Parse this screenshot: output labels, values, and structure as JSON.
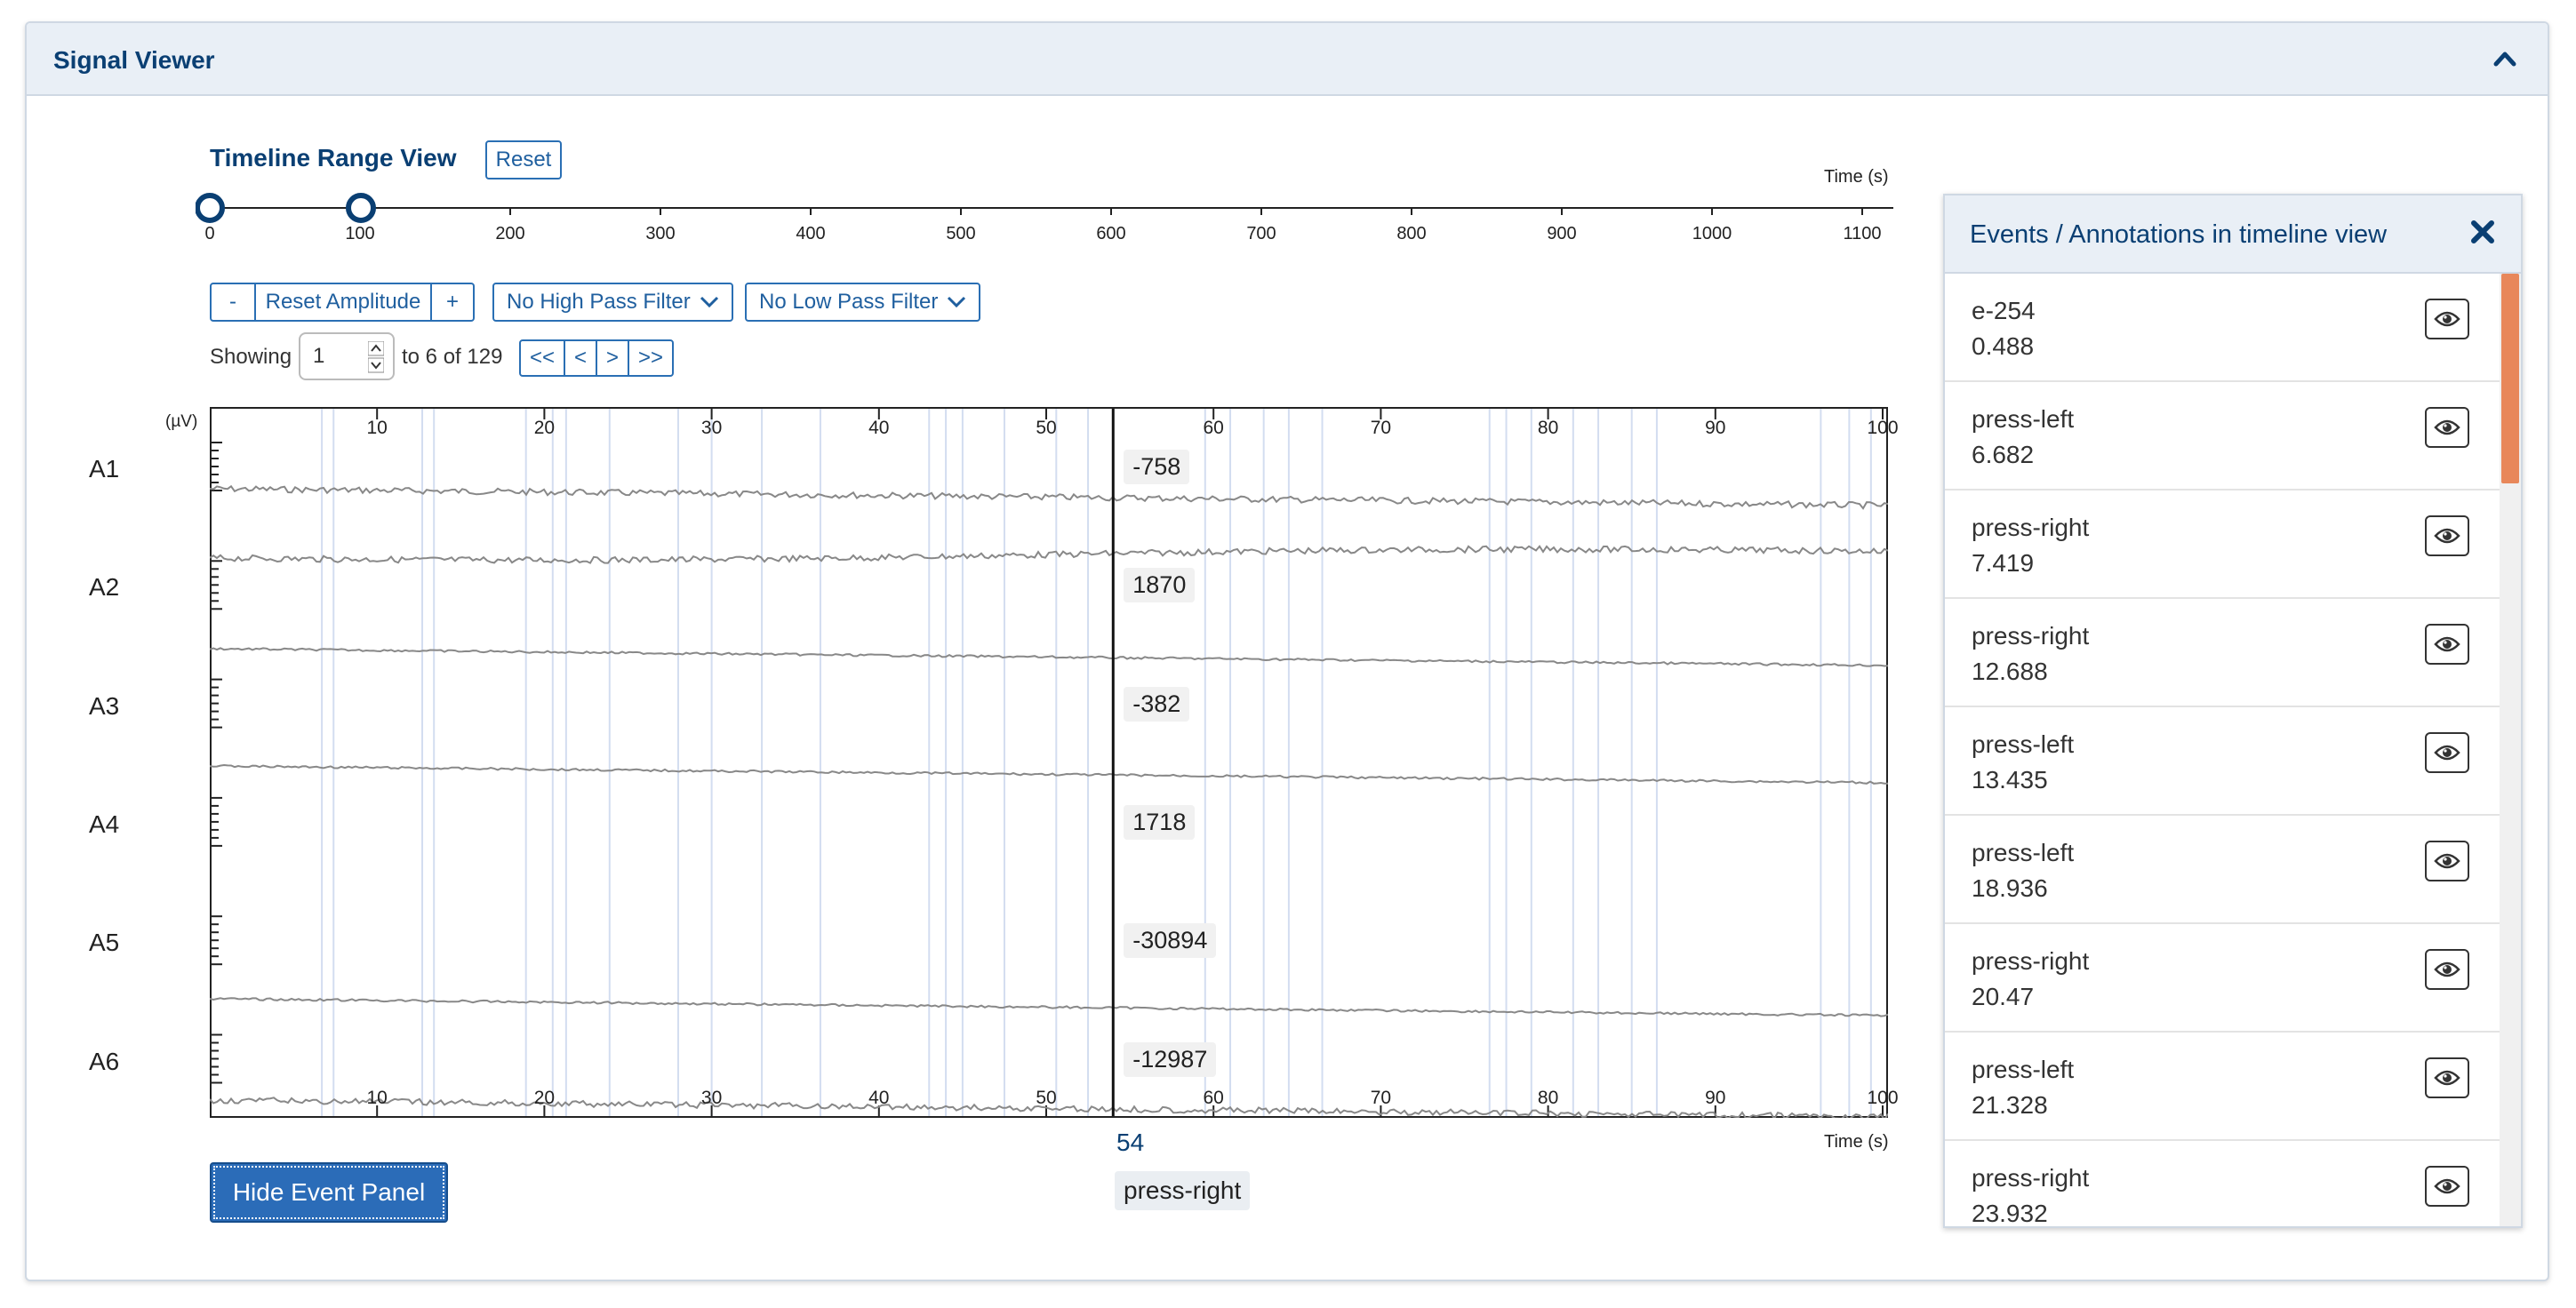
{
  "panel": {
    "title": "Signal Viewer"
  },
  "timeline": {
    "title": "Timeline Range View",
    "reset_label": "Reset",
    "axis_label": "Time (s)",
    "ticks": [
      "0",
      "100",
      "200",
      "300",
      "400",
      "500",
      "600",
      "700",
      "800",
      "900",
      "1000",
      "1100"
    ],
    "range_start": 0,
    "range_end": 100
  },
  "controls": {
    "amp_minus": "-",
    "amp_reset": "Reset Amplitude",
    "amp_plus": "+",
    "high_pass": "No High Pass Filter",
    "low_pass": "No Low Pass Filter",
    "showing_label": "Showing",
    "showing_value": "1",
    "showing_suffix": "to 6 of 129",
    "nav_first": "<<",
    "nav_prev": "<",
    "nav_next": ">",
    "nav_last": ">>"
  },
  "plot": {
    "unit_label": "(µV)",
    "axis_label": "Time (s)",
    "ticks": [
      "10",
      "20",
      "30",
      "40",
      "50",
      "60",
      "70",
      "80",
      "90",
      "100"
    ],
    "channels": [
      {
        "name": "A1",
        "value": "-758"
      },
      {
        "name": "A2",
        "value": "1870"
      },
      {
        "name": "A3",
        "value": "-382"
      },
      {
        "name": "A4",
        "value": "1718"
      },
      {
        "name": "A5",
        "value": "-30894"
      },
      {
        "name": "A6",
        "value": "-12987"
      }
    ],
    "cursor_time": "54",
    "cursor_event": "press-right"
  },
  "hide_event_panel": "Hide Event Panel",
  "events_panel": {
    "title": "Events / Annotations in timeline view",
    "items": [
      {
        "name": "e-254",
        "time": "0.488"
      },
      {
        "name": "press-left",
        "time": "6.682"
      },
      {
        "name": "press-right",
        "time": "7.419"
      },
      {
        "name": "press-right",
        "time": "12.688"
      },
      {
        "name": "press-left",
        "time": "13.435"
      },
      {
        "name": "press-left",
        "time": "18.936"
      },
      {
        "name": "press-right",
        "time": "20.47"
      },
      {
        "name": "press-left",
        "time": "21.328"
      },
      {
        "name": "press-right",
        "time": "23.932"
      }
    ]
  },
  "colors": {
    "brand": "#0a3f73",
    "accent": "#2b6cb8",
    "scroll": "#e8875a"
  }
}
